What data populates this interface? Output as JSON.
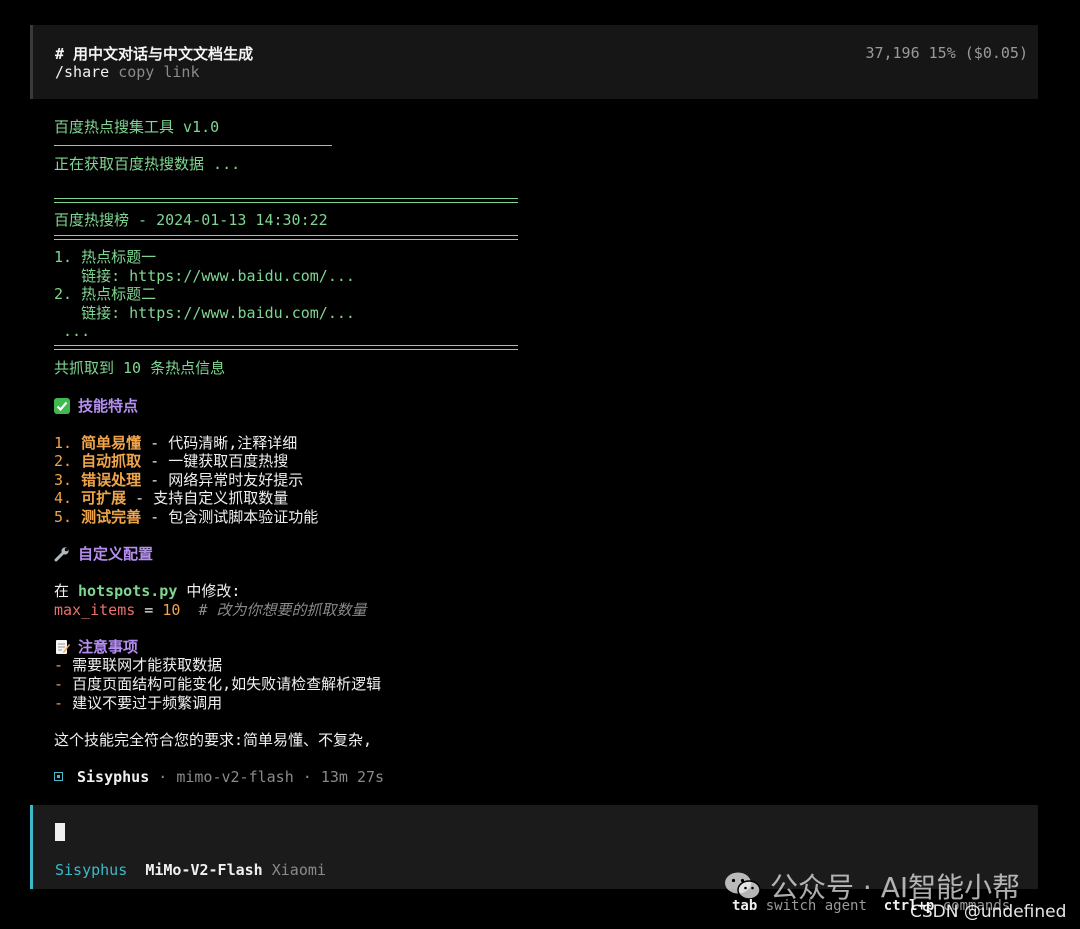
{
  "header": {
    "title": "# 用中文对话与中文文档生成",
    "share_cmd": "/share",
    "share_hint": "copy link",
    "tokens": "37,196",
    "usage": "15% ($0.05)"
  },
  "output": {
    "tool_name": "百度热点搜集工具 v1.0",
    "fetching": "正在获取百度热搜数据 ...",
    "board_title": "百度热搜榜 - 2024-01-13 14:30:22",
    "items": [
      {
        "num": "1.",
        "title": "热点标题一",
        "link_label": "链接:",
        "link": "https://www.baidu.com/..."
      },
      {
        "num": "2.",
        "title": "热点标题二",
        "link_label": "链接:",
        "link": "https://www.baidu.com/..."
      }
    ],
    "ellipsis": "...",
    "summary": "共抓取到 10 条热点信息"
  },
  "features": {
    "heading": "技能特点",
    "icon": "check-mark-icon",
    "list": [
      {
        "num": "1.",
        "name": "简单易懂",
        "desc": " - 代码清晰,注释详细"
      },
      {
        "num": "2.",
        "name": "自动抓取",
        "desc": " - 一键获取百度热搜"
      },
      {
        "num": "3.",
        "name": "错误处理",
        "desc": " - 网络异常时友好提示"
      },
      {
        "num": "4.",
        "name": "可扩展",
        "desc": " - 支持自定义抓取数量"
      },
      {
        "num": "5.",
        "name": "测试完善",
        "desc": " - 包含测试脚本验证功能"
      }
    ]
  },
  "config": {
    "heading": "自定义配置",
    "icon": "wrench-icon",
    "prefix": "在 ",
    "file": "hotspots.py",
    "suffix": " 中修改:",
    "var": "max_items",
    "eq": " = ",
    "value": "10",
    "comment": "  # 改为你想要的抓取数量"
  },
  "notes": {
    "heading": "注意事项",
    "icon": "memo-icon",
    "list": [
      "需要联网才能获取数据",
      "百度页面结构可能变化,如失败请检查解析逻辑",
      "建议不要过于频繁调用"
    ],
    "bullet": "-"
  },
  "closing": "这个技能完全符合您的要求:简单易懂、不复杂,",
  "status": {
    "agent": "Sisyphus",
    "sep": " · ",
    "model": "mimo-v2-flash",
    "elapsed": "13m 27s"
  },
  "input": {
    "agent": "Sisyphus",
    "model": "MiMo-V2-Flash",
    "provider": "Xiaomi"
  },
  "hints": {
    "tab_key": "tab",
    "tab_desc": " switch agent",
    "ctrl_key": "ctrl+p",
    "ctrl_desc": " commands"
  },
  "watermark": {
    "text": "公众号 · AI智能小帮",
    "csdn": "CSDN @undefined"
  },
  "colors": {
    "green": "#7fd691",
    "orange": "#f0a54a",
    "purple": "#b48ef0",
    "cyan": "#3bbac9",
    "red": "#e8716a"
  }
}
